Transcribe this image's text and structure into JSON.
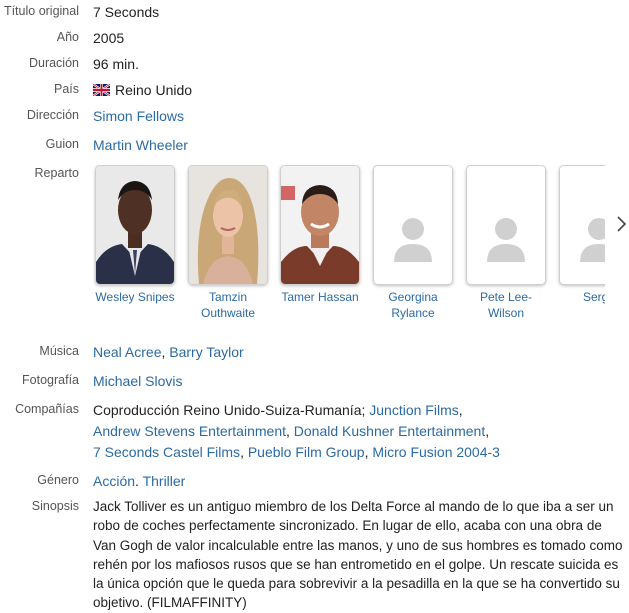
{
  "fields": {
    "titulo_label": "Título original",
    "titulo_value": "7 Seconds",
    "anio_label": "Año",
    "anio_value": "2005",
    "duracion_label": "Duración",
    "duracion_value": "96 min.",
    "pais_label": "País",
    "pais_value": "Reino Unido",
    "direccion_label": "Dirección",
    "direccion_value": "Simon Fellows",
    "guion_label": "Guion",
    "guion_value": "Martin Wheeler",
    "reparto_label": "Reparto",
    "musica_label": "Música",
    "musica_1": "Neal Acree",
    "musica_2": "Barry Taylor",
    "fotografia_label": "Fotografía",
    "fotografia_value": "Michael Slovis",
    "companias_label": "Compañías",
    "companias_prefix": "Coproducción Reino Unido-Suiza-Rumanía;",
    "companias_links": [
      "Junction Films",
      "Andrew Stevens Entertainment",
      "Donald Kushner Entertainment",
      "7 Seconds Castel Films",
      "Pueblo Film Group",
      "Micro Fusion 2004-3"
    ],
    "genero_label": "Género",
    "genero_1": "Acción",
    "genero_2": "Thriller",
    "sinopsis_label": "Sinopsis",
    "sinopsis_text": "Jack Tolliver es un antiguo miembro de los Delta Force al mando de lo que iba a ser un robo de coches perfectamente sincronizado. En lugar de ello, acaba con una obra de Van Gogh de valor incalculable entre las manos, y uno de sus hombres es tomado como rehén por los mafiosos rusos que se han entrometido en el golpe. Un rescate suicida es la única opción que le queda para sobrevivir a la pesadilla en la que se ha convertido su objetivo. (FILMAFFINITY)"
  },
  "cast": [
    {
      "line1": "Wesley Snipes",
      "line2": ""
    },
    {
      "line1": "Tamzin",
      "line2": "Outhwaite"
    },
    {
      "line1": "Tamer Hassan",
      "line2": ""
    },
    {
      "line1": "Georgina",
      "line2": "Rylance"
    },
    {
      "line1": "Pete Lee-",
      "line2": "Wilson"
    },
    {
      "line1": "Serge",
      "line2": ""
    }
  ],
  "icons": {
    "flag": "uk-flag-icon",
    "placeholder": "user-placeholder-icon",
    "next": "chevron-right-icon"
  },
  "colors": {
    "link": "#2c6aa3",
    "label": "#555555"
  }
}
